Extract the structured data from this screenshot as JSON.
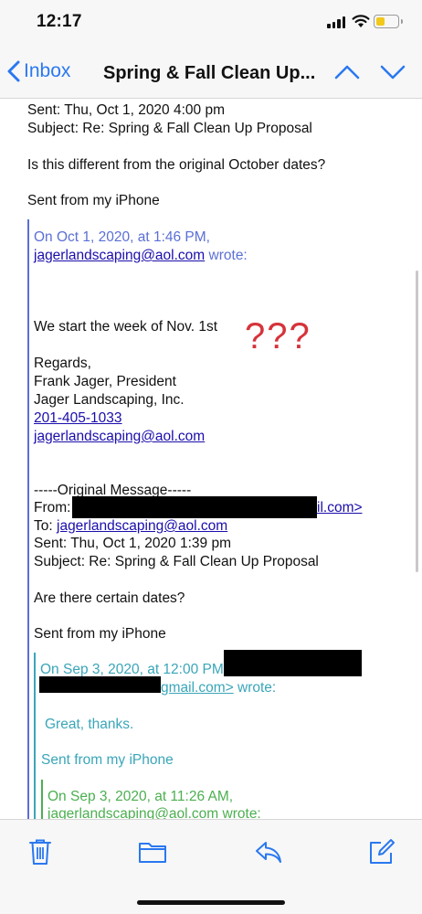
{
  "status": {
    "time": "12:17"
  },
  "nav": {
    "back_label": "Inbox",
    "title": "Spring & Fall Clean Up..."
  },
  "email": {
    "sent_line": "Sent: Thu, Oct 1, 2020 4:00 pm",
    "subject_line": "Subject: Re: Spring & Fall Clean Up Proposal",
    "question": "Is this different from the original October dates?",
    "signature": "Sent from my iPhone",
    "quote1": {
      "header": "On Oct 1, 2020, at 1:46 PM,",
      "sender_email": "jagerlandscaping@aol.com",
      "wrote": "wrote:",
      "body": "We start the week of Nov. 1st",
      "annotation": "???",
      "regards": "Regards,",
      "name": "Frank Jager, President",
      "company": "Jager Landscaping, Inc.",
      "phone": "201-405-1033",
      "email": "jagerlandscaping@aol.com",
      "original_message": "-----Original Message-----",
      "from_label": "From:",
      "from_tail": "il.com>",
      "to_label": "To:",
      "to_email": "jagerlandscaping@aol.com",
      "sent": "Sent: Thu, Oct 1, 2020 1:39 pm",
      "subject": "Subject: Re: Spring & Fall Clean Up Proposal",
      "question": "Are there certain dates?",
      "signature": "Sent from my iPhone"
    },
    "quote2": {
      "header": "On Sep 3, 2020, at 12:00 PM",
      "email_tail": "gmail.com>",
      "wrote": "wrote:",
      "body": "Great, thanks.",
      "signature": "Sent from my iPhone"
    },
    "quote3": {
      "header": "On Sep 3, 2020, at 11:26 AM,",
      "sender_email": "jagerlandscaping@aol.com",
      "wrote": "wrote:"
    }
  },
  "toolbar": {
    "icons": [
      "trash-icon",
      "folder-icon",
      "reply-icon",
      "compose-icon"
    ]
  },
  "colors": {
    "accent": "#2a78f0",
    "annotation": "#d6333a",
    "quote1": "#5b6fd6",
    "quote2": "#3aa6b9",
    "quote3": "#4caf50"
  }
}
